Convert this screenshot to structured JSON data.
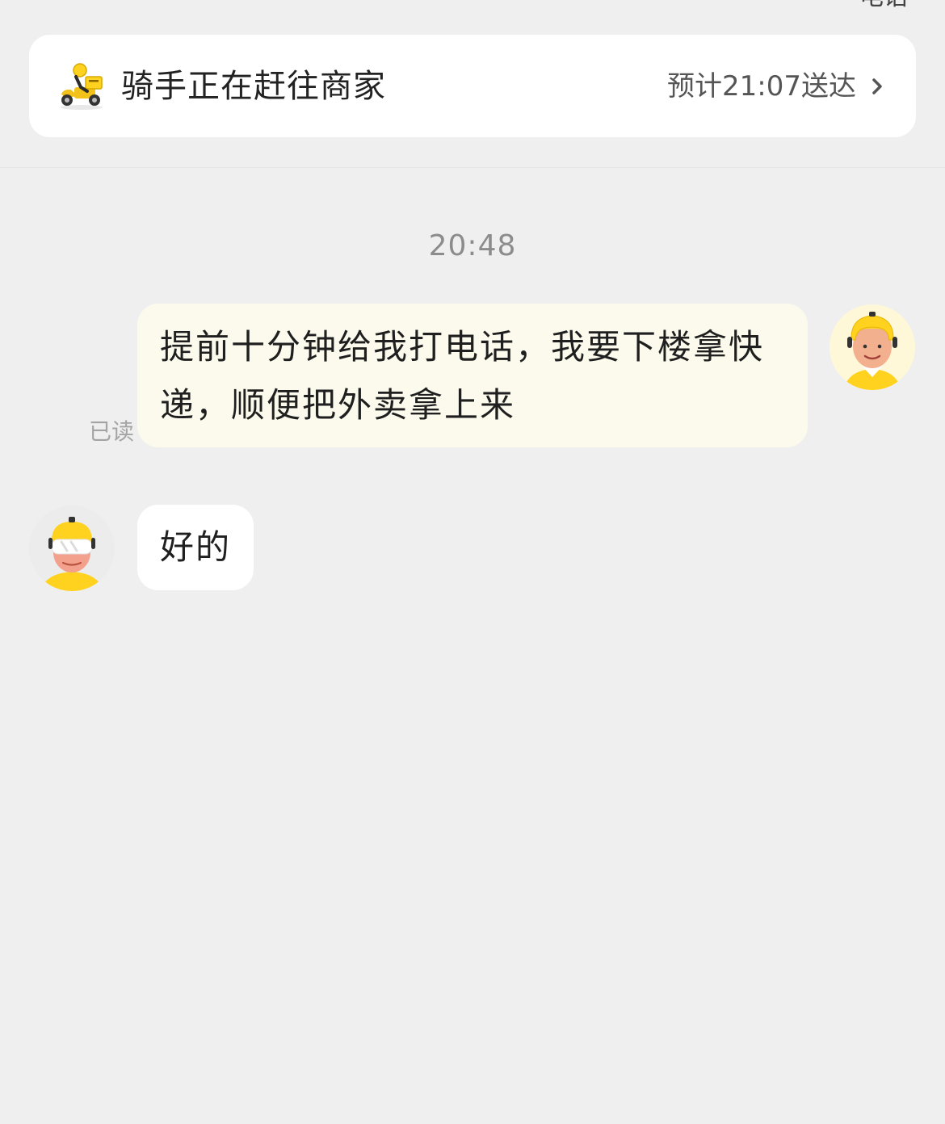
{
  "header": {
    "cutoff_text": "电话"
  },
  "status_card": {
    "icon": "rider-scooter-icon",
    "status": "骑手正在赶往商家",
    "eta": "预计21:07送达",
    "chevron": "chevron-right-icon"
  },
  "chat": {
    "timestamp": "20:48",
    "messages": [
      {
        "sender": "user",
        "text": "提前十分钟给我打电话，我要下楼拿快递，顺便把外卖拿上来",
        "read_status": "已读",
        "avatar": "user-avatar-icon"
      },
      {
        "sender": "rider",
        "text": "好的",
        "avatar": "rider-avatar-icon"
      }
    ]
  },
  "colors": {
    "background": "#efefef",
    "card": "#ffffff",
    "outgoing_bubble": "#fbfaec",
    "incoming_bubble": "#ffffff",
    "accent_yellow": "#ffd21f",
    "muted_text": "#8c8c8c"
  }
}
